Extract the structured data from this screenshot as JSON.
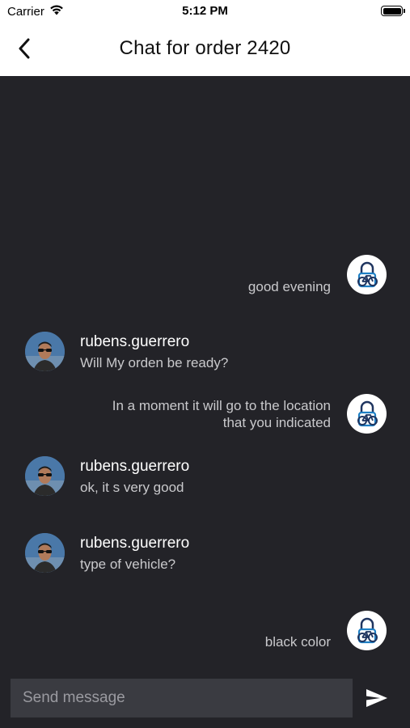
{
  "status_bar": {
    "carrier": "Carrier",
    "time": "5:12 PM",
    "icons": [
      "wifi-icon",
      "battery-icon"
    ]
  },
  "header": {
    "title": "Chat for order 2420",
    "back_icon": "chevron-left-icon"
  },
  "messages": [
    {
      "direction": "outgoing",
      "text": "good evening",
      "avatar": "bike-lock-logo"
    },
    {
      "direction": "incoming",
      "sender": "rubens.guerrero",
      "text": "Will My orden be ready?",
      "avatar": "user-photo"
    },
    {
      "direction": "outgoing",
      "text_lines": [
        "In a moment it will go to the location",
        "that you indicated"
      ],
      "avatar": "bike-lock-logo"
    },
    {
      "direction": "incoming",
      "sender": "rubens.guerrero",
      "text": "ok, it s very good",
      "avatar": "user-photo"
    },
    {
      "direction": "incoming",
      "sender": "rubens.guerrero",
      "text": "type of vehicle?",
      "avatar": "user-photo"
    },
    {
      "direction": "outgoing",
      "text": "black color",
      "avatar": "bike-lock-logo"
    }
  ],
  "composer": {
    "placeholder": "Send message",
    "value": "",
    "send_icon": "send-icon"
  },
  "colors": {
    "background": "#232328",
    "header": "#ffffff",
    "input": "#3a3b41",
    "logo_blue": "#1e7fc4",
    "logo_dark": "#1f3560"
  }
}
